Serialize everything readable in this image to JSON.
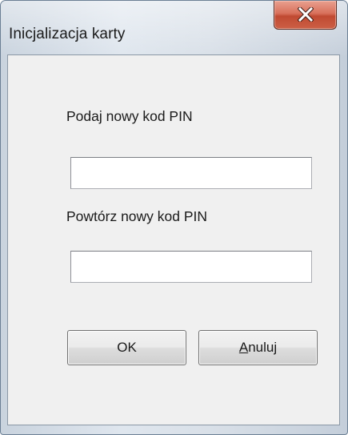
{
  "window": {
    "title": "Inicjalizacja karty",
    "close_icon": "close-icon",
    "accent_close": "#c9533c"
  },
  "form": {
    "pin_label": "Podaj nowy kod PIN",
    "pin_value": "",
    "repeat_label": "Powtórz nowy kod PIN",
    "repeat_value": ""
  },
  "buttons": {
    "ok_label": "OK",
    "cancel_accel": "A",
    "cancel_rest": "nuluj"
  }
}
